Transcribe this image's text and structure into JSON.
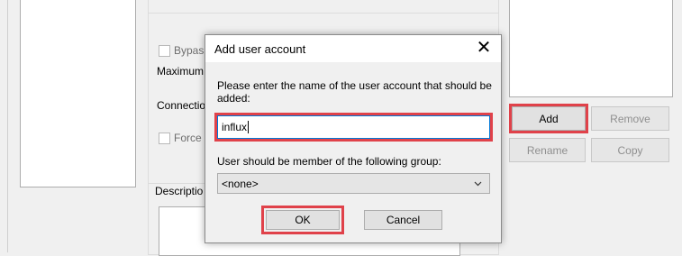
{
  "background": {
    "bypass_label": "Bypas",
    "maximum_label": "Maximum",
    "connection_label": "Connectio",
    "force_label": "Force",
    "description_label": "Descriptio",
    "buttons": {
      "add": "Add",
      "remove": "Remove",
      "rename": "Rename",
      "copy": "Copy"
    }
  },
  "dialog": {
    "title": "Add user account",
    "prompt": "Please enter the name of the user account that should be added:",
    "username_value": "influx",
    "group_label": "User should be member of the following group:",
    "group_selected": "<none>",
    "ok_label": "OK",
    "cancel_label": "Cancel"
  },
  "colors": {
    "highlight": "#e0424a",
    "focus_border": "#0078d7"
  },
  "icons": {
    "close": "close-icon",
    "dropdown": "chevron-down-icon"
  }
}
